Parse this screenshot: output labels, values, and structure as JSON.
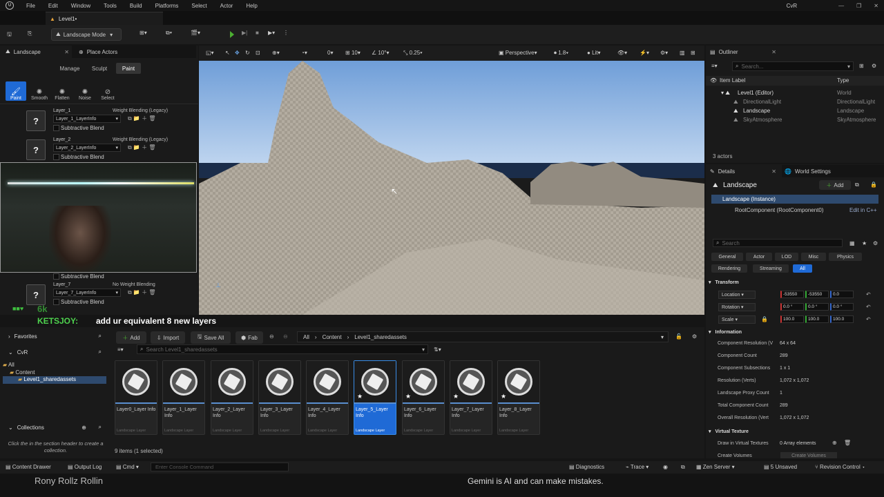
{
  "menu": [
    "File",
    "Edit",
    "Window",
    "Tools",
    "Build",
    "Platforms",
    "Select",
    "Actor",
    "Help"
  ],
  "project_name": "CvR",
  "level_tab": "Level1•",
  "toolbar": {
    "mode": "Landscape Mode"
  },
  "left_panel": {
    "tab_landscape": "Landscape",
    "tab_place_actors": "Place Actors",
    "modes": [
      "Manage",
      "Sculpt",
      "Paint"
    ],
    "tools": [
      "Paint",
      "Smooth",
      "Flatten",
      "Noise",
      "Select"
    ],
    "layers": [
      {
        "name": "Layer_1",
        "blend": "Weight Blending (Legacy)",
        "info": "Layer_1_LayerInfo",
        "sub": "Subtractive Blend"
      },
      {
        "name": "Layer_2",
        "blend": "Weight Blending (Legacy)",
        "info": "Layer_2_LayerInfo",
        "sub": "Subtractive Blend"
      },
      {
        "name": "",
        "blend": "",
        "info": "",
        "sub": "Subtractive Blend"
      },
      {
        "name": "Layer_7",
        "blend": "No Weight Blending",
        "info": "Layer_7_LayerInfo",
        "sub": "Subtractive Blend"
      }
    ]
  },
  "chat": {
    "user": "KETSJOY:",
    "message": "add ur equivalent 8 new layers",
    "ghost": "6k"
  },
  "viewport": {
    "perspective": "Perspective",
    "fov": "1.8",
    "lit": "Lit",
    "grid1": "0",
    "grid2": "10",
    "angle": "10°",
    "scale": "0.25"
  },
  "content_browser": {
    "favorites": "Favorites",
    "project": "CvR",
    "tree": [
      "All",
      "Content",
      "Level1_sharedassets"
    ],
    "collections": "Collections",
    "collections_hint": "Click the  in the section header to create a collection.",
    "add": "Add",
    "import": "Import",
    "save_all": "Save All",
    "fab": "Fab",
    "path": [
      "All",
      "Content",
      "Level1_sharedassets"
    ],
    "search_placeholder": "Search Level1_sharedassets",
    "items_count": "9 items (1 selected)",
    "assets": [
      {
        "name": "Layer0_Layer Info",
        "type": "Landscape Layer"
      },
      {
        "name": "Layer_1_Layer Info",
        "type": "Landscape Layer"
      },
      {
        "name": "Layer_2_Layer Info",
        "type": "Landscape Layer"
      },
      {
        "name": "Layer_3_Layer Info",
        "type": "Landscape Layer"
      },
      {
        "name": "Layer_4_Layer Info",
        "type": "Landscape Layer"
      },
      {
        "name": "Layer_5_Layer Info",
        "type": "Landscape Layer"
      },
      {
        "name": "Layer_6_Layer Info",
        "type": "Landscape Layer"
      },
      {
        "name": "Layer_7_Layer Info",
        "type": "Landscape Layer"
      },
      {
        "name": "Layer_8_Layer Info",
        "type": "Landscape Layer"
      }
    ]
  },
  "outliner": {
    "title": "Outliner",
    "search": "Search...",
    "col_label": "Item Label",
    "col_type": "Type",
    "rows": [
      {
        "label": "Level1 (Editor)",
        "type": "World"
      },
      {
        "label": "DirectionalLight",
        "type": "DirectionalLight"
      },
      {
        "label": "Landscape",
        "type": "Landscape"
      },
      {
        "label": "SkyAtmosphere",
        "type": "SkyAtmosphere"
      }
    ],
    "count": "3 actors"
  },
  "details": {
    "tab": "Details",
    "tab2": "World Settings",
    "object": "Landscape",
    "add": "Add",
    "instance": "Landscape (Instance)",
    "root": "RootComponent (RootComponent0)",
    "edit_cpp": "Edit in C++",
    "search": "Search",
    "filters": [
      "General",
      "Actor",
      "LOD",
      "Misc",
      "Physics",
      "Rendering",
      "Streaming",
      "All"
    ],
    "transform": "Transform",
    "location": "Location",
    "rotation": "Rotation",
    "scale": "Scale",
    "loc_vals": [
      "-53550",
      "-53550",
      "0.0"
    ],
    "rot_vals": [
      "0.0 °",
      "0.0 °",
      "0.0 °"
    ],
    "scale_vals": [
      "100.0",
      "100.0",
      "100.0"
    ],
    "information": "Information",
    "info_rows": [
      {
        "k": "Component Resolution (V",
        "v": "64 x 64"
      },
      {
        "k": "Component Count",
        "v": "289"
      },
      {
        "k": "Component Subsections",
        "v": "1 x 1"
      },
      {
        "k": "Resolution (Verts)",
        "v": "1,072 x 1,072"
      },
      {
        "k": "Landscape Proxy Count",
        "v": "1"
      },
      {
        "k": "Total Component Count",
        "v": "289"
      },
      {
        "k": "Overall Resolution (Vert",
        "v": "1,072 x 1,072"
      }
    ],
    "virtual_texture": "Virtual Texture",
    "draw_vt": "Draw in Virtual Textures",
    "draw_vt_val": "0 Array elements",
    "create_volumes": "Create Volumes",
    "create_volumes_btn": "Create Volumes"
  },
  "status": {
    "content_drawer": "Content Drawer",
    "output_log": "Output Log",
    "cmd": "Cmd",
    "console": "Enter Console Command",
    "diagnostics": "Diagnostics",
    "trace": "Trace",
    "zen": "Zen Server",
    "unsaved": "5 Unsaved",
    "revision": "Revision Control"
  },
  "overlay": {
    "names": "Rony   Rollz   Rollin",
    "gemini": "Gemini is AI and can make mistakes."
  }
}
